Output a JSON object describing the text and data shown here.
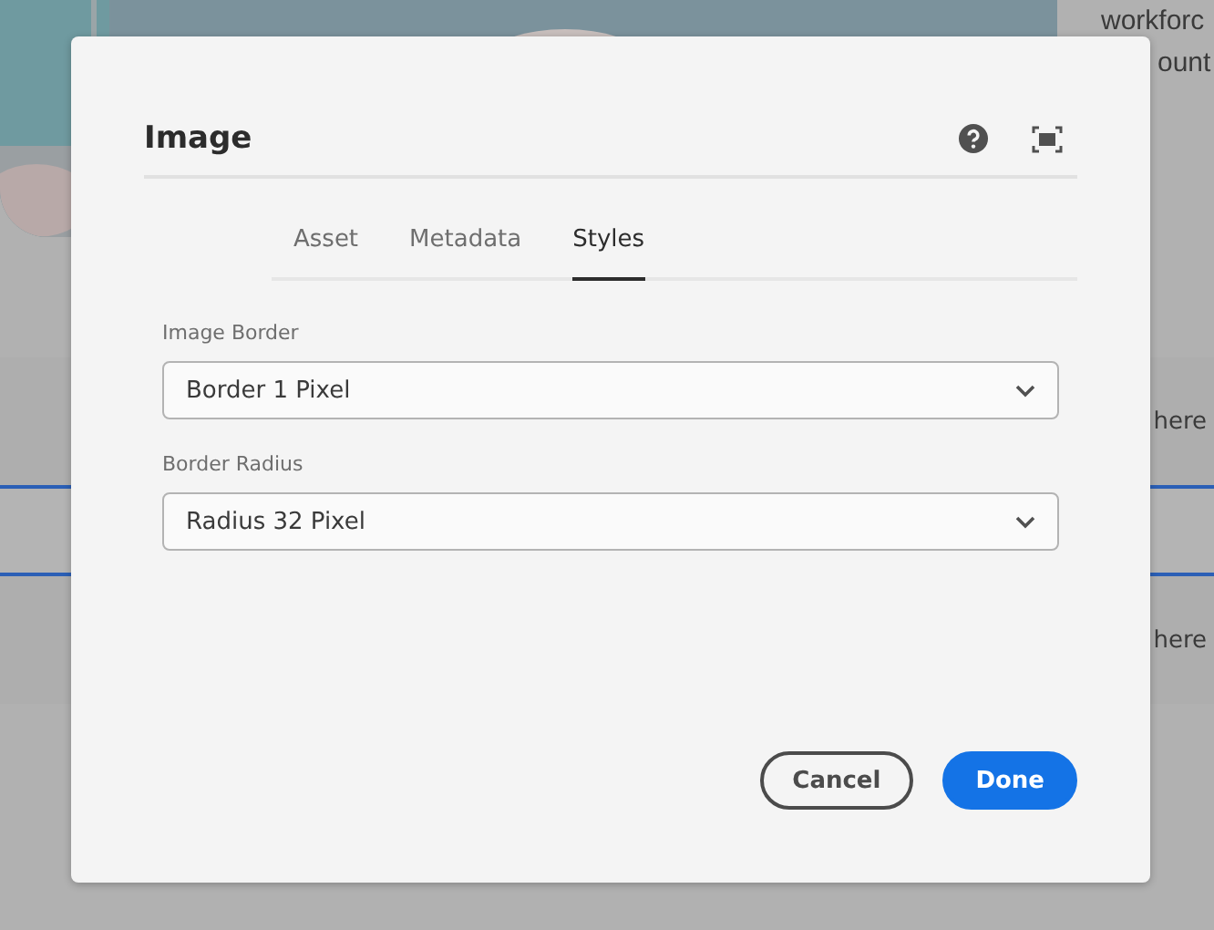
{
  "background": {
    "side_texts": [
      "workforc",
      "ount"
    ],
    "row_texts": [
      "here",
      "here"
    ]
  },
  "dialog": {
    "title": "Image",
    "tabs": [
      {
        "label": "Asset",
        "selected": false
      },
      {
        "label": "Metadata",
        "selected": false
      },
      {
        "label": "Styles",
        "selected": true
      }
    ],
    "fields": [
      {
        "label": "Image Border",
        "value": "Border 1 Pixel"
      },
      {
        "label": "Border Radius",
        "value": "Radius 32 Pixel"
      }
    ],
    "buttons": [
      {
        "label": "Cancel",
        "kind": "secondary"
      },
      {
        "label": "Done",
        "kind": "primary"
      }
    ]
  }
}
